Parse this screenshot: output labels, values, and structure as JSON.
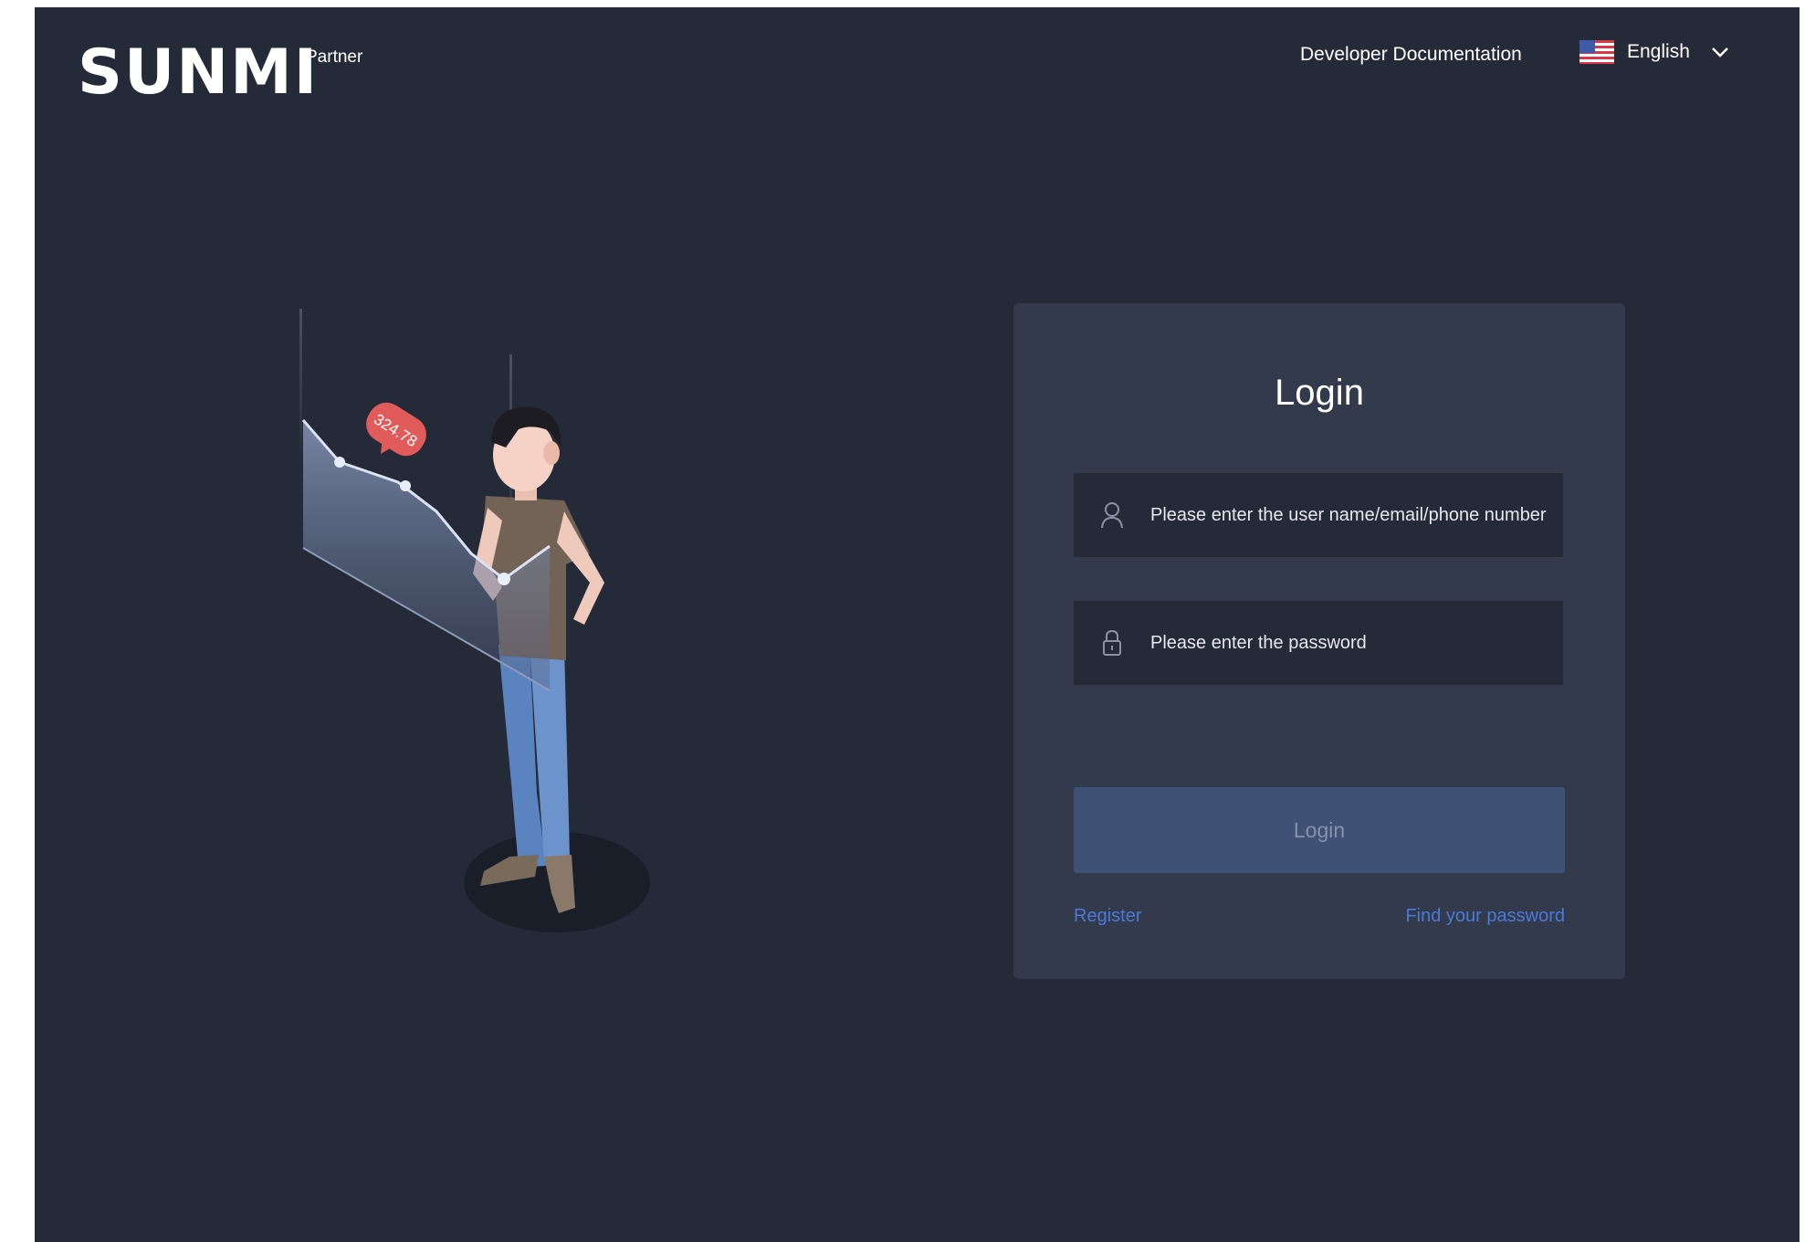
{
  "header": {
    "logo_text": "SUNMI",
    "logo_superscript": "Partner",
    "doc_link": "Developer Documentation",
    "language": {
      "flag_icon": "us-flag-icon",
      "selected": "English",
      "dropdown_icon": "chevron-down-icon"
    }
  },
  "illustration": {
    "badge_value": "324.78"
  },
  "login": {
    "title": "Login",
    "username_placeholder": "Please enter the user name/email/phone number",
    "username_icon": "user-icon",
    "password_placeholder": "Please enter the password",
    "password_icon": "lock-icon",
    "submit_label": "Login",
    "register_link": "Register",
    "forgot_link": "Find your password"
  },
  "colors": {
    "background": "#252a38",
    "card": "#333a4b",
    "input_bg": "#252a38",
    "button_disabled": "#3f5276",
    "link": "#4a7ad8"
  }
}
